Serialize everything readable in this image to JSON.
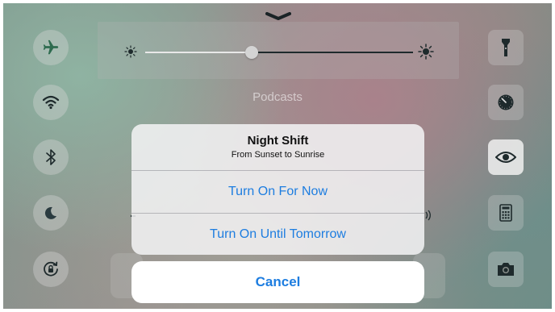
{
  "control_center": {
    "podcasts_label": "Podcasts",
    "brightness_level": 0.36
  },
  "night_shift_sheet": {
    "title": "Night Shift",
    "subtitle": "From Sunset to Sunrise",
    "options": [
      {
        "label": "Turn On For Now"
      },
      {
        "label": "Turn On Until Tomorrow"
      }
    ],
    "cancel_label": "Cancel"
  },
  "colors": {
    "accent": "#1d7de0",
    "airplane_icon": "#2e6b4f",
    "night_icon": "#2a3b40"
  },
  "icons": [
    "chevron-down-icon",
    "sun-small-icon",
    "sun-large-icon",
    "airplane-icon",
    "wifi-icon",
    "bluetooth-icon",
    "moon-icon",
    "rotation-lock-icon",
    "flashlight-icon",
    "timer-icon",
    "eye-icon",
    "calculator-icon",
    "camera-icon",
    "airplay-icon"
  ]
}
